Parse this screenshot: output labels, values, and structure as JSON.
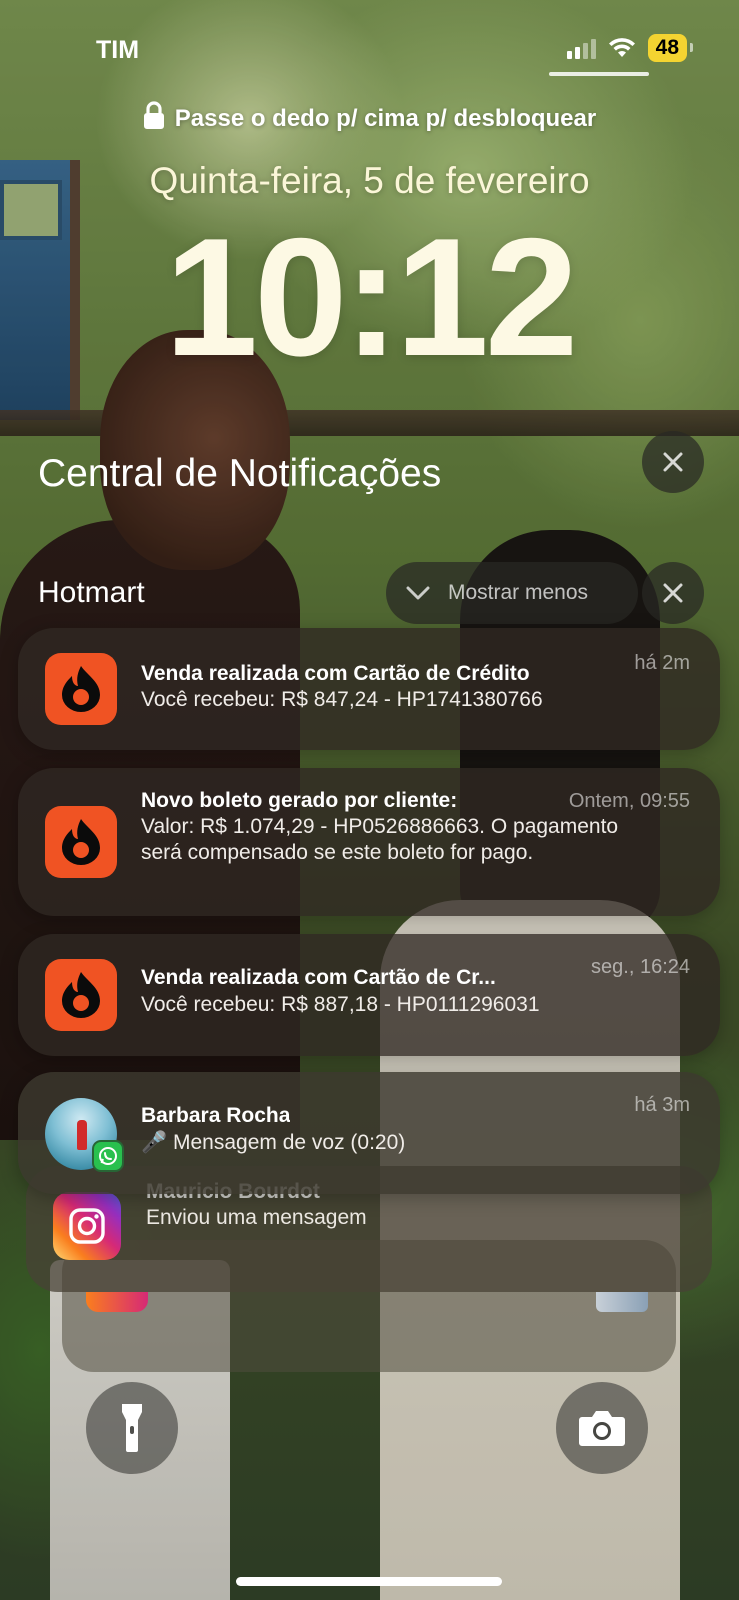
{
  "status_bar": {
    "carrier": "TIM",
    "battery": "48",
    "icons": [
      "signal-icon",
      "wifi-icon",
      "battery-icon"
    ]
  },
  "lock_screen": {
    "unlock_hint": "Passe o dedo p/ cima p/ desbloquear",
    "date": "Quinta-feira, 5 de fevereiro",
    "time": "10:12"
  },
  "notification_center": {
    "title": "Central de Notificações",
    "group": {
      "app_name": "Hotmart",
      "show_less_label": "Mostrar menos"
    },
    "notifications": [
      {
        "app": "Hotmart",
        "title": "Venda realizada com Cartão de Crédito",
        "time": "há 2m",
        "body": "Você recebeu: R$ 847,24 - HP1741380766"
      },
      {
        "app": "Hotmart",
        "title": "Novo boleto gerado por cliente:",
        "time": "Ontem, 09:55",
        "body": "Valor: R$ 1.074,29 - HP0526886663. O pagamento será compensado se este boleto for pago."
      },
      {
        "app": "Hotmart",
        "title": "Venda realizada com Cartão de Cr...",
        "time": "seg., 16:24",
        "body": "Você recebeu: R$ 887,18 - HP0111296031"
      },
      {
        "app": "WhatsApp",
        "title": "Barbara Rocha",
        "time": "há 3m",
        "body": "🎤 Mensagem de voz (0:20)"
      }
    ],
    "stacked": {
      "app": "Instagram",
      "title": "Mauricio Bourdot",
      "body": "Enviou uma mensagem"
    }
  },
  "colors": {
    "hotmart_orange": "#f05323",
    "battery_yellow": "#f4d431",
    "whatsapp_green": "#29c04e"
  }
}
